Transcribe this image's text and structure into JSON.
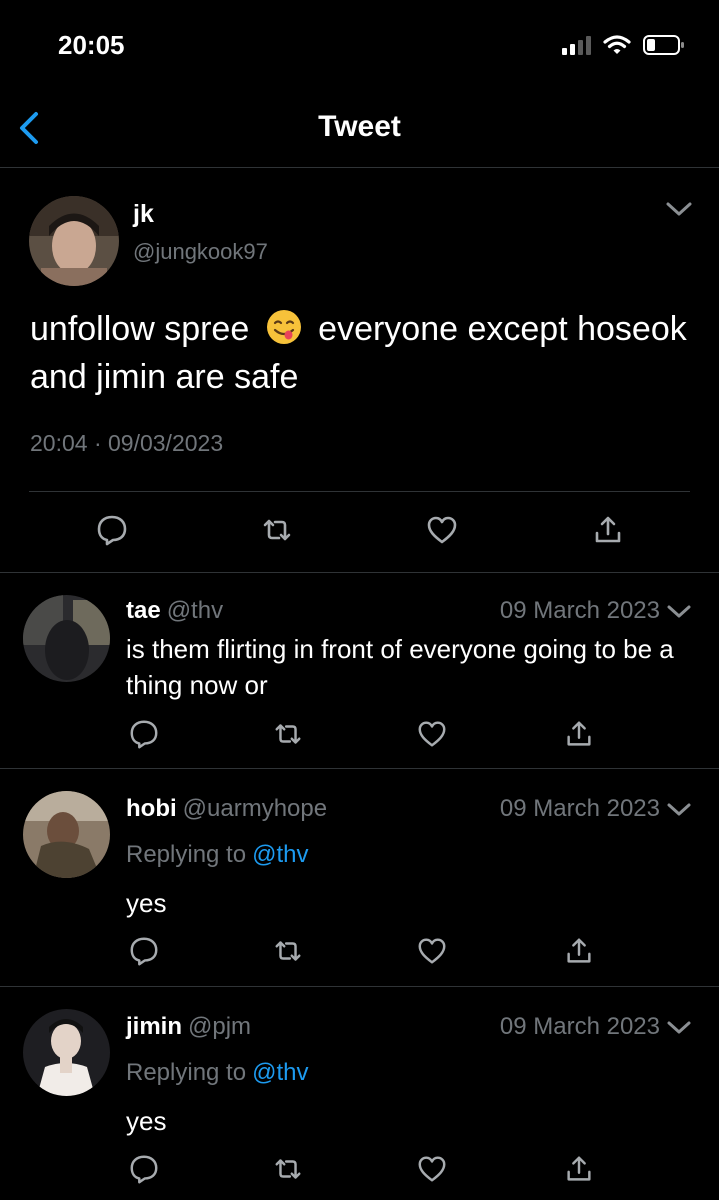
{
  "status_bar": {
    "time": "20:05"
  },
  "nav": {
    "title": "Tweet"
  },
  "main_tweet": {
    "name": "jk",
    "handle": "@jungkook97",
    "text_before_emoji": "unfollow spree",
    "emoji": "face-savoring-food-emoji",
    "text_after_emoji": "everyone except hoseok and jimin are safe",
    "timestamp": "20:04 · 09/03/2023"
  },
  "replies": [
    {
      "name": "tae",
      "handle": "@thv",
      "date": "09 March 2023",
      "text": "is them flirting in front of everyone going to be a thing now or",
      "replying_to_label": "",
      "replying_to_handle": ""
    },
    {
      "name": "hobi",
      "handle": "@uarmyhope",
      "date": "09 March 2023",
      "replying_to_label": "Replying to",
      "replying_to_handle": "@thv",
      "text": "yes"
    },
    {
      "name": "jimin",
      "handle": "@pjm",
      "date": "09 March 2023",
      "replying_to_label": "Replying to",
      "replying_to_handle": "@thv",
      "text": "yes"
    }
  ],
  "icons": {
    "reply": "reply-icon",
    "retweet": "retweet-icon",
    "like": "heart-icon",
    "share": "share-icon"
  },
  "colors": {
    "background": "#000000",
    "accent": "#1d9bf0",
    "secondary_text": "#71767b",
    "divider": "#2f3336"
  }
}
